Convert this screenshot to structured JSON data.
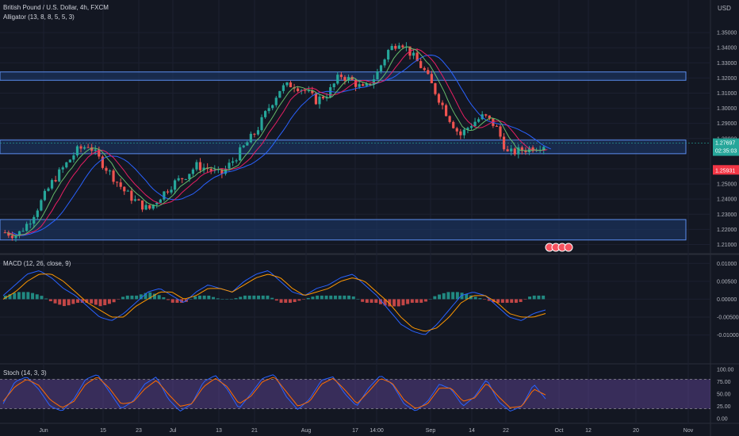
{
  "header": {
    "symbol_title": "British Pound / U.S. Dollar, 4h, FXCM",
    "currency": "USD",
    "indicator": "Alligator (13, 8, 8, 5, 5, 3)"
  },
  "price_tags": {
    "last_price": "1.27697",
    "countdown": "02:35:03",
    "low_marker": "1.25931"
  },
  "colors": {
    "background": "#131722",
    "candle_up": "#26a69a",
    "candle_down": "#ef5350",
    "jaw": "#2962ff",
    "teeth": "#e91e63",
    "lips": "#66bb6a",
    "zone": "#1e3a6e",
    "macd_line": "#2962ff",
    "signal_line": "#ff9800",
    "stoch_k": "#2962ff",
    "stoch_d": "#ff6d00",
    "stoch_band": "#7e57c2"
  },
  "chart_data": [
    {
      "type": "candlestick",
      "title": "British Pound / U.S. Dollar, 4h, FXCM",
      "ylim": [
        1.205,
        1.36
      ],
      "y_ticks": [
        "1.35000",
        "1.34000",
        "1.33000",
        "1.32000",
        "1.31000",
        "1.30000",
        "1.29000",
        "1.28000",
        "1.26000",
        "1.25000",
        "1.24000",
        "1.23000",
        "1.22000",
        "1.21000"
      ],
      "x_ticks": [
        "Jun",
        "15",
        "23",
        "Jul",
        "13",
        "21",
        "Aug",
        "17",
        "14:00",
        "Sep",
        "14",
        "22",
        "Oct",
        "12",
        "20",
        "Nov"
      ],
      "series": [
        {
          "name": "Close",
          "values": [
            1.218,
            1.216,
            1.225,
            1.238,
            1.252,
            1.262,
            1.272,
            1.276,
            1.265,
            1.255,
            1.245,
            1.238,
            1.233,
            1.242,
            1.25,
            1.255,
            1.262,
            1.26,
            1.256,
            1.265,
            1.275,
            1.285,
            1.3,
            1.313,
            1.316,
            1.312,
            1.305,
            1.31,
            1.322,
            1.318,
            1.312,
            1.322,
            1.338,
            1.345,
            1.335,
            1.325,
            1.31,
            1.295,
            1.282,
            1.29,
            1.295,
            1.288,
            1.27,
            1.272,
            1.274,
            1.276
          ]
        }
      ],
      "zones": [
        {
          "from": 1.3185,
          "to": 1.324
        },
        {
          "from": 1.27,
          "to": 1.279
        },
        {
          "from": 1.213,
          "to": 1.2265
        }
      ]
    },
    {
      "type": "line",
      "title": "MACD (12, 26, close, 9)",
      "ylim": [
        -0.0112,
        0.0105
      ],
      "y_ticks": [
        "0.01000",
        "0.00500",
        "0.00000",
        "-0.00500",
        "-0.01000"
      ],
      "series": [
        {
          "name": "MACD",
          "values": [
            0.001,
            0.004,
            0.007,
            0.008,
            0.006,
            0.003,
            0.001,
            -0.002,
            -0.005,
            -0.006,
            -0.004,
            -0.001,
            0.002,
            0.003,
            0.001,
            -0.001,
            0.002,
            0.004,
            0.003,
            0.002,
            0.005,
            0.007,
            0.008,
            0.005,
            0.002,
            0.001,
            0.003,
            0.004,
            0.006,
            0.007,
            0.004,
            0.001,
            -0.003,
            -0.007,
            -0.009,
            -0.01,
            -0.007,
            -0.003,
            0.001,
            0.002,
            0.001,
            -0.002,
            -0.005,
            -0.006,
            -0.004,
            -0.003
          ]
        },
        {
          "name": "Signal",
          "values": [
            0.0,
            0.002,
            0.005,
            0.007,
            0.007,
            0.005,
            0.002,
            -0.001,
            -0.003,
            -0.005,
            -0.005,
            -0.002,
            0.0,
            0.002,
            0.002,
            0.0,
            0.001,
            0.003,
            0.003,
            0.002,
            0.004,
            0.006,
            0.007,
            0.006,
            0.003,
            0.001,
            0.002,
            0.003,
            0.005,
            0.006,
            0.005,
            0.002,
            -0.001,
            -0.005,
            -0.008,
            -0.009,
            -0.008,
            -0.005,
            -0.001,
            0.001,
            0.001,
            -0.001,
            -0.004,
            -0.005,
            -0.005,
            -0.004
          ]
        }
      ]
    },
    {
      "type": "line",
      "title": "Stoch (14, 3, 3)",
      "ylim": [
        0,
        100
      ],
      "y_ticks": [
        "100.00",
        "75.00",
        "50.00",
        "25.00",
        "0.00"
      ],
      "band": [
        20,
        80
      ],
      "series": [
        {
          "name": "%K",
          "values": [
            30,
            75,
            85,
            60,
            25,
            15,
            40,
            80,
            90,
            55,
            20,
            35,
            70,
            85,
            40,
            15,
            30,
            75,
            88,
            60,
            20,
            50,
            82,
            90,
            45,
            18,
            40,
            78,
            85,
            50,
            25,
            62,
            88,
            70,
            30,
            15,
            35,
            70,
            60,
            25,
            45,
            80,
            35,
            15,
            25,
            70,
            40
          ]
        },
        {
          "name": "%D",
          "values": [
            35,
            65,
            80,
            68,
            38,
            22,
            35,
            70,
            85,
            62,
            30,
            33,
            60,
            78,
            50,
            25,
            30,
            65,
            82,
            65,
            30,
            45,
            75,
            85,
            55,
            25,
            35,
            70,
            82,
            58,
            30,
            55,
            82,
            72,
            38,
            20,
            30,
            62,
            62,
            35,
            42,
            72,
            45,
            22,
            25,
            60,
            48
          ]
        }
      ]
    }
  ]
}
